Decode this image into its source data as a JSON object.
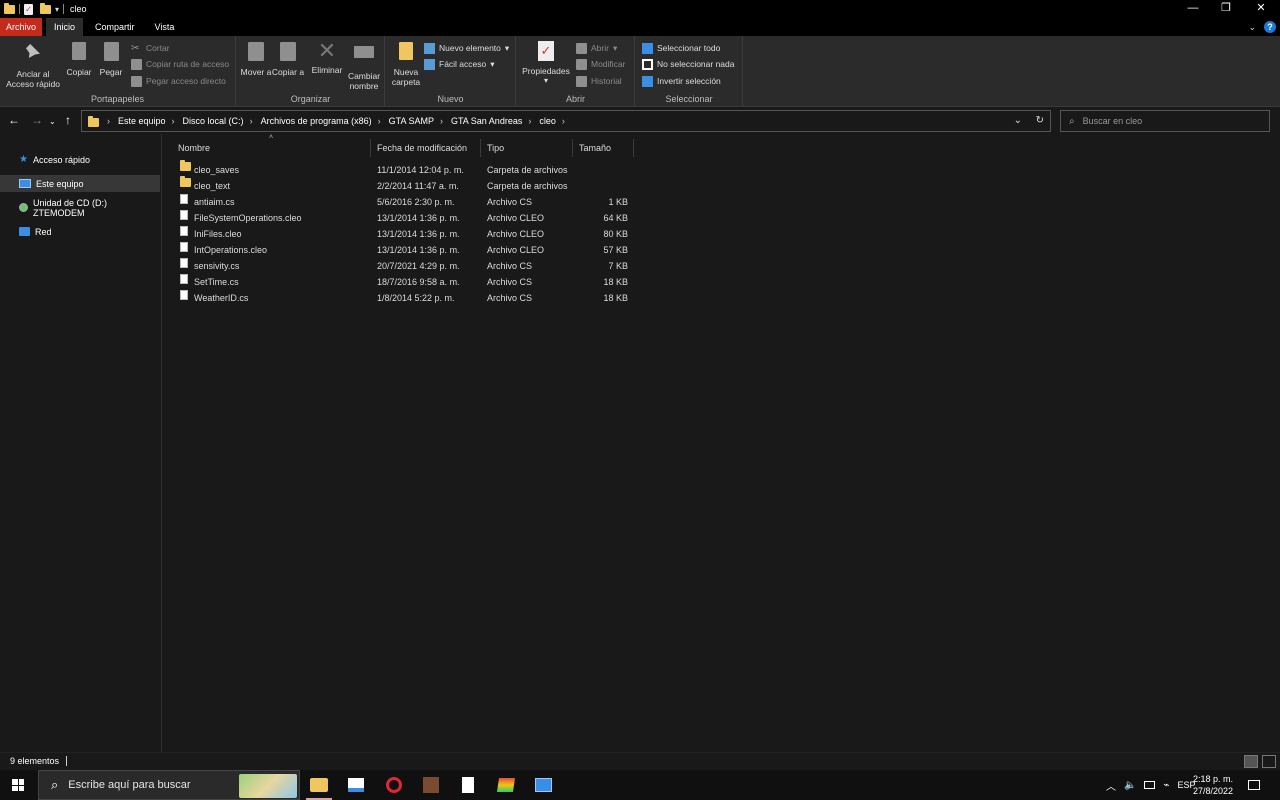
{
  "window": {
    "title": "cleo",
    "minimize_glyph": "—",
    "restore_glyph": "❐",
    "close_glyph": "✕"
  },
  "ribbon_tabs": [
    "Archivo",
    "Inicio",
    "Compartir",
    "Vista"
  ],
  "ribbon": {
    "portapapeles": {
      "label": "Portapapeles",
      "pin": "Anclar al Acceso rápido",
      "copy": "Copiar",
      "paste": "Pegar",
      "cut": "Cortar",
      "copy_path": "Copiar ruta de acceso",
      "paste_shortcut": "Pegar acceso directo"
    },
    "organizar": {
      "label": "Organizar",
      "move": "Mover a",
      "copy_to": "Copiar a",
      "delete": "Eliminar",
      "rename": "Cambiar nombre"
    },
    "nuevo": {
      "label": "Nuevo",
      "new_folder": "Nueva carpeta",
      "new_item": "Nuevo elemento",
      "easy_access": "Fácil acceso"
    },
    "abrir": {
      "label": "Abrir",
      "properties": "Propiedades",
      "open": "Abrir",
      "edit": "Modificar",
      "history": "Historial"
    },
    "seleccionar": {
      "label": "Seleccionar",
      "select_all": "Seleccionar todo",
      "select_none": "No seleccionar nada",
      "invert": "Invertir selección"
    }
  },
  "address": {
    "crumbs": [
      "Este equipo",
      "Disco local (C:)",
      "Archivos de programa (x86)",
      "GTA SAMP",
      "GTA San Andreas",
      "cleo"
    ],
    "search_placeholder": "Buscar en cleo"
  },
  "nav_pane": [
    {
      "label": "Acceso rápido",
      "icon": "star-icon"
    },
    {
      "label": "Este equipo",
      "icon": "computer-icon",
      "selected": true
    },
    {
      "label": "Unidad de CD (D:) ZTEMODEM",
      "icon": "cd-drive-icon"
    },
    {
      "label": "Red",
      "icon": "network-icon"
    }
  ],
  "columns": [
    "Nombre",
    "Fecha de modificación",
    "Tipo",
    "Tamaño"
  ],
  "files": [
    {
      "name": "cleo_saves",
      "date": "11/1/2014 12:04 p. m.",
      "type": "Carpeta de archivos",
      "size": "",
      "icon": "folder-icon"
    },
    {
      "name": "cleo_text",
      "date": "2/2/2014 11:47 a. m.",
      "type": "Carpeta de archivos",
      "size": "",
      "icon": "folder-icon"
    },
    {
      "name": "antiaim.cs",
      "date": "5/6/2016 2:30 p. m.",
      "type": "Archivo CS",
      "size": "1 KB",
      "icon": "file-icon"
    },
    {
      "name": "FileSystemOperations.cleo",
      "date": "13/1/2014 1:36 p. m.",
      "type": "Archivo CLEO",
      "size": "64 KB",
      "icon": "file-icon"
    },
    {
      "name": "IniFiles.cleo",
      "date": "13/1/2014 1:36 p. m.",
      "type": "Archivo CLEO",
      "size": "80 KB",
      "icon": "file-icon"
    },
    {
      "name": "IntOperations.cleo",
      "date": "13/1/2014 1:36 p. m.",
      "type": "Archivo CLEO",
      "size": "57 KB",
      "icon": "file-icon"
    },
    {
      "name": "sensivity.cs",
      "date": "20/7/2021 4:29 p. m.",
      "type": "Archivo CS",
      "size": "7 KB",
      "icon": "file-icon"
    },
    {
      "name": "SetTime.cs",
      "date": "18/7/2016 9:58 a. m.",
      "type": "Archivo CS",
      "size": "18 KB",
      "icon": "file-icon"
    },
    {
      "name": "WeatherID.cs",
      "date": "1/8/2014 5:22 p. m.",
      "type": "Archivo CS",
      "size": "18 KB",
      "icon": "file-icon"
    }
  ],
  "status": {
    "items_count": "9 elementos"
  },
  "taskbar": {
    "search_placeholder": "Escribe aquí para buscar",
    "lang": "ESP",
    "time": "2:18 p. m.",
    "date": "27/8/2022"
  },
  "colors": {
    "accent_file_tab": "#c42b1c",
    "folder": "#f0c75e",
    "selected_nav": "#373737"
  }
}
